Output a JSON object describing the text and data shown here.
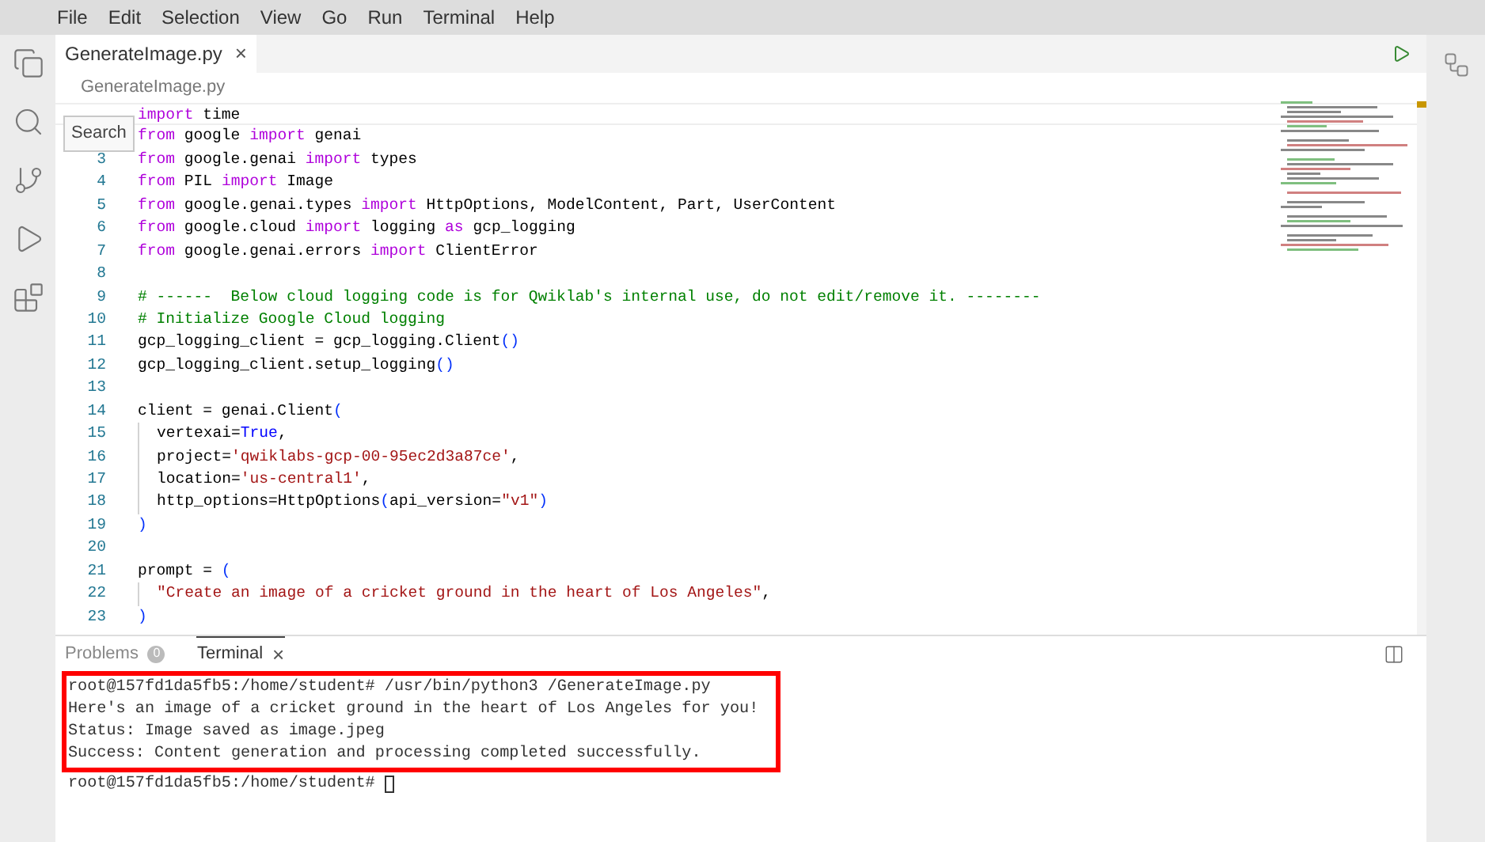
{
  "menu": [
    "File",
    "Edit",
    "Selection",
    "View",
    "Go",
    "Run",
    "Terminal",
    "Help"
  ],
  "tabs": [
    {
      "label": "GenerateImage.py",
      "close": "×",
      "selected": true
    }
  ],
  "breadcrumb": "GenerateImage.py",
  "tooltip": "Search",
  "code": [
    {
      "segments": [
        {
          "kind": "kw",
          "text": "import"
        },
        {
          "kind": "plain",
          "text": " time"
        }
      ]
    },
    {
      "segments": [
        {
          "kind": "kw",
          "text": "from"
        },
        {
          "kind": "plain",
          "text": " google "
        },
        {
          "kind": "kw",
          "text": "import"
        },
        {
          "kind": "plain",
          "text": " genai"
        }
      ]
    },
    {
      "number": "3",
      "segments": [
        {
          "kind": "kw",
          "text": "from"
        },
        {
          "kind": "plain",
          "text": " google.genai "
        },
        {
          "kind": "kw",
          "text": "import"
        },
        {
          "kind": "plain",
          "text": " types"
        }
      ]
    },
    {
      "number": "4",
      "segments": [
        {
          "kind": "kw",
          "text": "from"
        },
        {
          "kind": "plain",
          "text": " PIL "
        },
        {
          "kind": "kw",
          "text": "import"
        },
        {
          "kind": "plain",
          "text": " Image"
        }
      ]
    },
    {
      "number": "5",
      "segments": [
        {
          "kind": "kw",
          "text": "from"
        },
        {
          "kind": "plain",
          "text": " google.genai.types "
        },
        {
          "kind": "kw",
          "text": "import"
        },
        {
          "kind": "plain",
          "text": " HttpOptions, ModelContent, Part, UserContent"
        }
      ]
    },
    {
      "number": "6",
      "segments": [
        {
          "kind": "kw",
          "text": "from"
        },
        {
          "kind": "plain",
          "text": " google.cloud "
        },
        {
          "kind": "kw",
          "text": "import"
        },
        {
          "kind": "plain",
          "text": " logging "
        },
        {
          "kind": "kw",
          "text": "as"
        },
        {
          "kind": "plain",
          "text": " gcp_logging"
        }
      ]
    },
    {
      "number": "7",
      "segments": [
        {
          "kind": "kw",
          "text": "from"
        },
        {
          "kind": "plain",
          "text": " google.genai.errors "
        },
        {
          "kind": "kw",
          "text": "import"
        },
        {
          "kind": "plain",
          "text": " ClientError"
        }
      ]
    },
    {
      "number": "8"
    },
    {
      "number": "9",
      "segments": [
        {
          "kind": "comment",
          "text": "# ------  Below cloud logging code is for Qwiklab's internal use, do not edit/remove it. --------"
        }
      ]
    },
    {
      "number": "10",
      "segments": [
        {
          "kind": "comment",
          "text": "# Initialize Google Cloud logging"
        }
      ]
    },
    {
      "number": "11",
      "segments": [
        {
          "kind": "plain",
          "text": "gcp_logging_client = gcp_logging.Client"
        },
        {
          "kind": "paren",
          "text": "()"
        }
      ]
    },
    {
      "number": "12",
      "segments": [
        {
          "kind": "plain",
          "text": "gcp_logging_client.setup_logging"
        },
        {
          "kind": "paren",
          "text": "()"
        }
      ]
    },
    {
      "number": "13"
    },
    {
      "number": "14",
      "segments": [
        {
          "kind": "plain",
          "text": "client = genai.Client"
        },
        {
          "kind": "paren",
          "text": "("
        }
      ]
    },
    {
      "number": "15",
      "indent": true,
      "segments": [
        {
          "kind": "plain",
          "text": "vertexai="
        },
        {
          "kind": "const",
          "text": "True"
        },
        {
          "kind": "plain",
          "text": ","
        }
      ]
    },
    {
      "number": "16",
      "indent": true,
      "segments": [
        {
          "kind": "plain",
          "text": "project="
        },
        {
          "kind": "str",
          "text": "'qwiklabs-gcp-00-95ec2d3a87ce'"
        },
        {
          "kind": "plain",
          "text": ","
        }
      ]
    },
    {
      "number": "17",
      "indent": true,
      "segments": [
        {
          "kind": "plain",
          "text": "location="
        },
        {
          "kind": "str",
          "text": "'us-central1'"
        },
        {
          "kind": "plain",
          "text": ","
        }
      ]
    },
    {
      "number": "18",
      "indent": true,
      "segments": [
        {
          "kind": "plain",
          "text": "http_options=HttpOptions"
        },
        {
          "kind": "paren",
          "text": "("
        },
        {
          "kind": "plain",
          "text": "api_version="
        },
        {
          "kind": "str",
          "text": "\"v1\""
        },
        {
          "kind": "paren",
          "text": ")"
        }
      ]
    },
    {
      "number": "19",
      "segments": [
        {
          "kind": "paren",
          "text": ")"
        }
      ]
    },
    {
      "number": "20"
    },
    {
      "number": "21",
      "segments": [
        {
          "kind": "plain",
          "text": "prompt = "
        },
        {
          "kind": "paren",
          "text": "("
        }
      ]
    },
    {
      "number": "22",
      "indent": true,
      "segments": [
        {
          "kind": "str",
          "text": "\"Create an image of a cricket ground in the heart of Los Angeles\""
        },
        {
          "kind": "plain",
          "text": ","
        }
      ]
    },
    {
      "number": "23",
      "segments": [
        {
          "kind": "paren",
          "text": ")"
        }
      ]
    }
  ],
  "panel_tabs": [
    {
      "label": "Problems",
      "badge": "0",
      "selected": false
    },
    {
      "label": "Terminal",
      "close": "×",
      "selected": true
    }
  ],
  "terminal": {
    "highlighted": [
      "root@157fd1da5fb5:/home/student# /usr/bin/python3 /GenerateImage.py",
      "Here's an image of a cricket ground in the heart of Los Angeles for you!",
      "Status: Image saved as image.jpeg",
      "Success: Content generation and processing completed successfully."
    ],
    "prompt": "root@157fd1da5fb5:/home/student# "
  }
}
